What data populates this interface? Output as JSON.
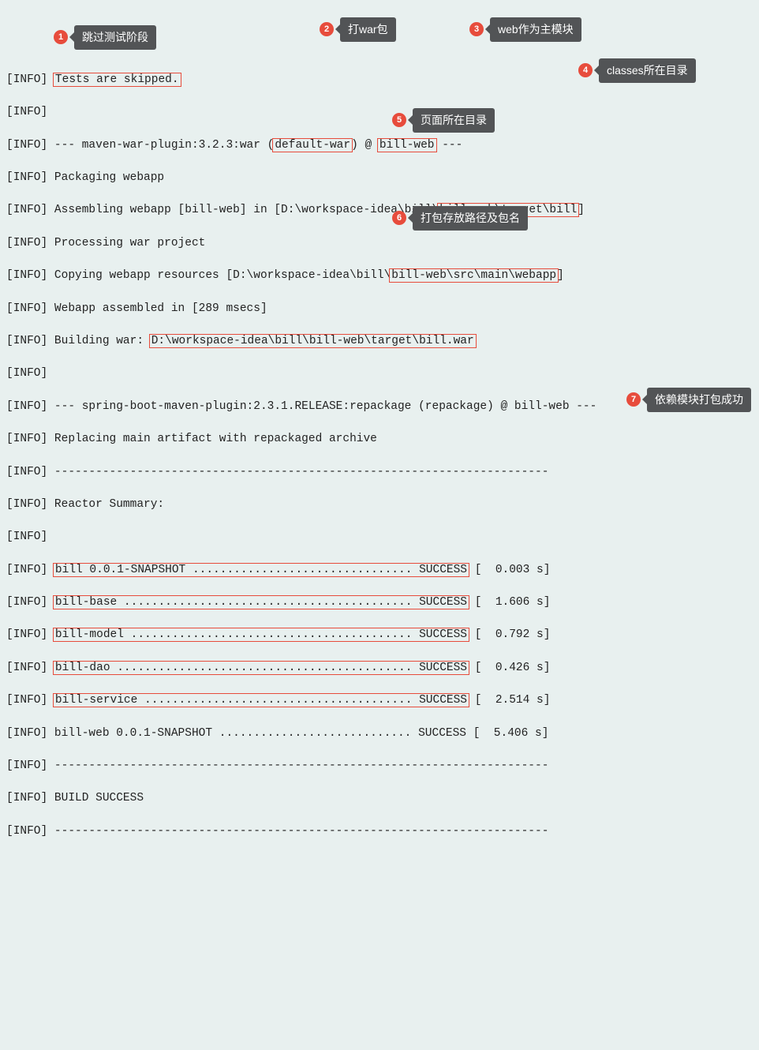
{
  "lines": {
    "l0": "[INFO] Tests are skipped.",
    "l1": "[INFO] ",
    "l2": "[INFO] --- maven-war-plugin:3.2.3:war (default-war) @ bill-web ---",
    "l3": "[INFO] Packaging webapp",
    "l4": "[INFO] Assembling webapp [bill-web] in [D:\\workspace-idea\\bill\\bill-web\\target\\bill]",
    "l5": "[INFO] Processing war project",
    "l6": "[INFO] Copying webapp resources [D:\\workspace-idea\\bill\\bill-web\\src\\main\\webapp]",
    "l7": "[INFO] Webapp assembled in [289 msecs]",
    "l8": "[INFO] Building war: D:\\workspace-idea\\bill\\bill-web\\target\\bill.war",
    "l9": "[INFO] ",
    "l10": "[INFO] --- spring-boot-maven-plugin:2.3.1.RELEASE:repackage (repackage) @ bill-web ---",
    "l11": "[INFO] Replacing main artifact with repackaged archive",
    "l12": "[INFO] ------------------------------------------------------------------------",
    "l13": "[INFO] Reactor Summary:",
    "l14": "[INFO] ",
    "l15": "[INFO] bill 0.0.1-SNAPSHOT ................................ SUCCESS [  0.003 s]",
    "l16": "[INFO] bill-base .......................................... SUCCESS [  1.606 s]",
    "l17": "[INFO] bill-model ......................................... SUCCESS [  0.792 s]",
    "l18": "[INFO] bill-dao ........................................... SUCCESS [  0.426 s]",
    "l19": "[INFO] bill-service ....................................... SUCCESS [  2.514 s]",
    "l20": "[INFO] bill-web 0.0.1-SNAPSHOT ............................ SUCCESS [  5.406 s]",
    "l21": "[INFO] ------------------------------------------------------------------------",
    "l22": "[INFO] BUILD SUCCESS",
    "l23": "[INFO] ------------------------------------------------------------------------"
  },
  "highlights": {
    "h_tests": "Tests are skipped.",
    "h_default_war": "default-war",
    "h_bill_web_goal": "bill-web",
    "h_classes_dir": "bill-web\\target\\bill",
    "h_webapp_dir": "bill-web\\src\\main\\webapp",
    "h_war_path": "D:\\workspace-idea\\bill\\bill-web\\target\\bill.war",
    "h_mod_bill": "bill 0.0.1-SNAPSHOT ................................ SUCCESS",
    "h_mod_base": "bill-base .......................................... SUCCESS",
    "h_mod_model": "bill-model ......................................... SUCCESS",
    "h_mod_dao": "bill-dao ........................................... SUCCESS",
    "h_mod_service": "bill-service ....................................... SUCCESS"
  },
  "annotations": {
    "a1": {
      "num": "1",
      "text": "跳过测试阶段"
    },
    "a2": {
      "num": "2",
      "text": "打war包"
    },
    "a3": {
      "num": "3",
      "text": "web作为主模块"
    },
    "a4": {
      "num": "4",
      "text": "classes所在目录"
    },
    "a5": {
      "num": "5",
      "text": "页面所在目录"
    },
    "a6": {
      "num": "6",
      "text": "打包存放路径及包名"
    },
    "a7": {
      "num": "7",
      "text": "依赖模块打包成功"
    }
  }
}
